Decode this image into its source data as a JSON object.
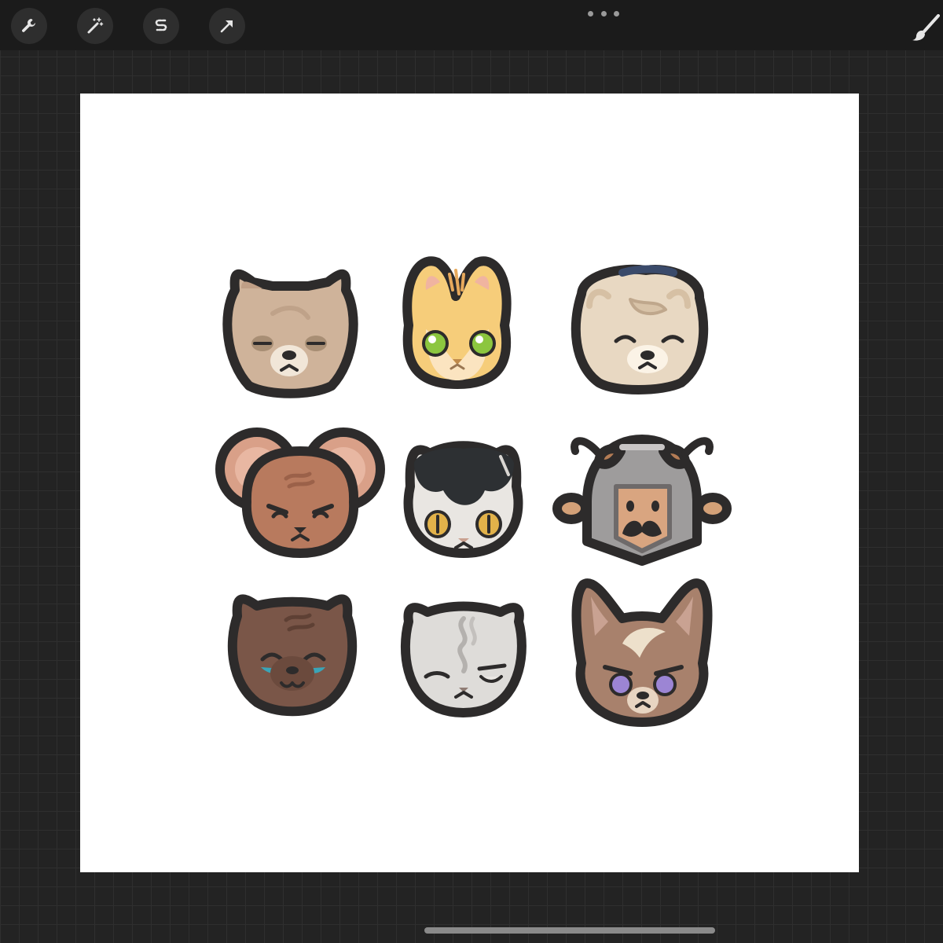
{
  "toolbar": {
    "tools": [
      {
        "name": "actions",
        "icon": "wrench-icon"
      },
      {
        "name": "adjustments",
        "icon": "magic-wand-icon"
      },
      {
        "name": "selection",
        "icon": "selection-s-icon"
      },
      {
        "name": "transform",
        "icon": "arrow-cursor-icon"
      }
    ],
    "more_icon": "more-dots-icon",
    "brush_icon": "brush-icon"
  },
  "colors": {
    "app_background": "#232323",
    "toolbar_background": "#1b1b1b",
    "canvas_background": "#ffffff",
    "sticker_outline": "#2d2b2b"
  },
  "canvas": {
    "stickers": [
      {
        "id": "tan-cat",
        "icon": "tan-cat-face"
      },
      {
        "id": "orange-bunny",
        "icon": "orange-bunny-face"
      },
      {
        "id": "sheepdog",
        "icon": "sheepdog-face"
      },
      {
        "id": "brown-mouse",
        "icon": "brown-mouse-face"
      },
      {
        "id": "tuxedo-cat",
        "icon": "tuxedo-cat-face"
      },
      {
        "id": "viking-cow",
        "icon": "viking-helmet-cow-face"
      },
      {
        "id": "brown-cat-crying",
        "icon": "brown-cat-crying-face"
      },
      {
        "id": "grey-cat",
        "icon": "grey-cat-face"
      },
      {
        "id": "fox-dog",
        "icon": "fox-dog-face"
      }
    ]
  }
}
